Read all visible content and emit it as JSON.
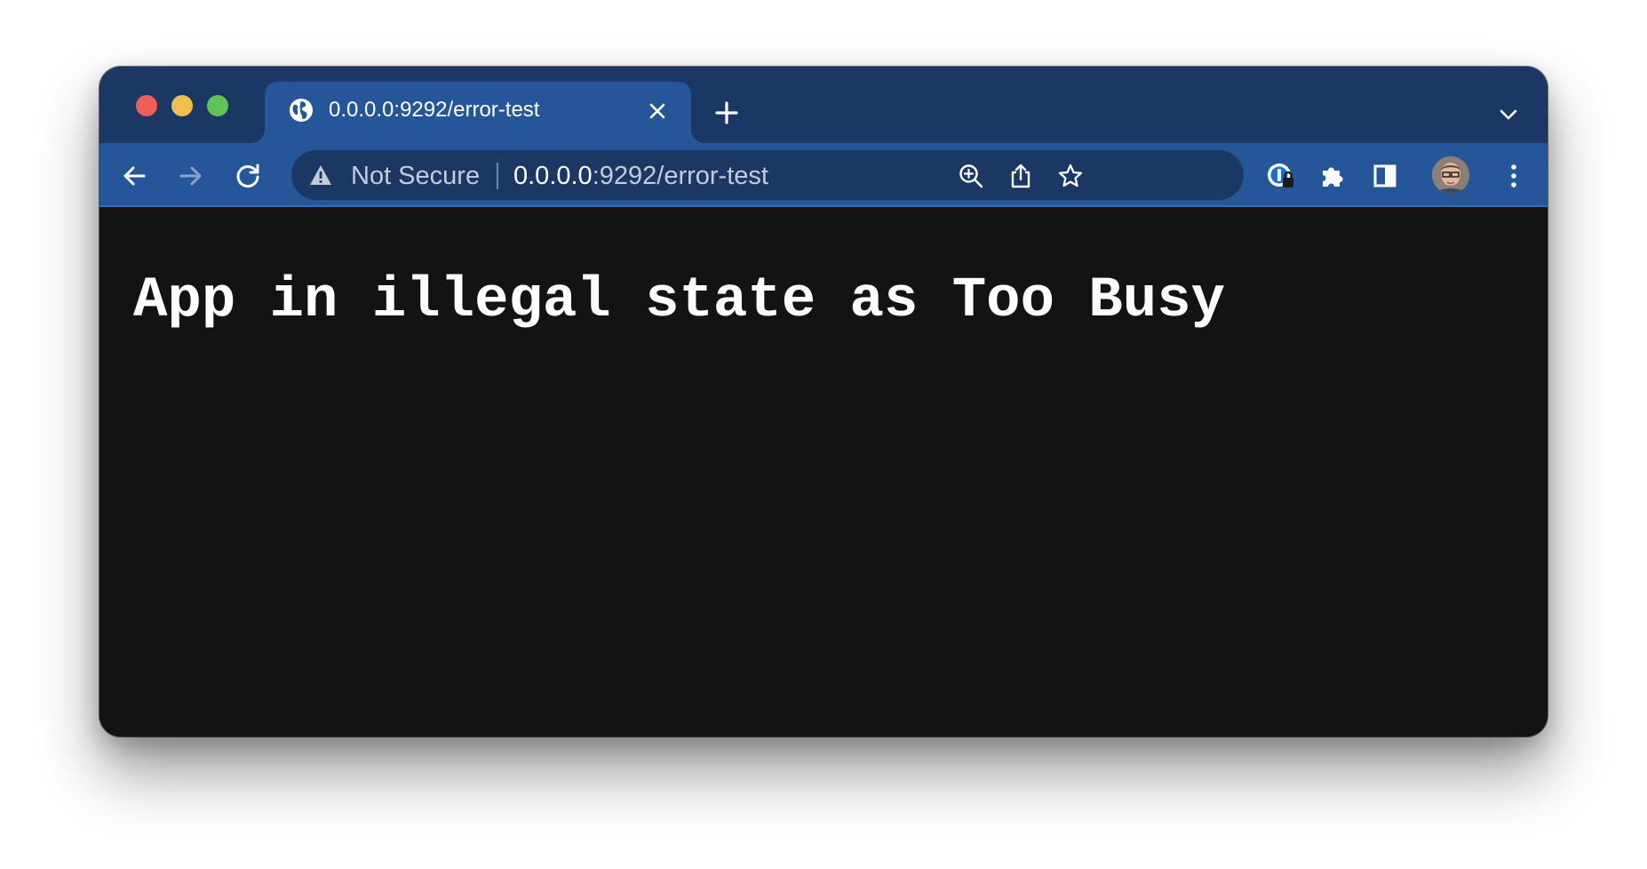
{
  "window": {
    "traffic_lights": {
      "close_color": "#ee5f57",
      "minimize_color": "#f4bd4f",
      "maximize_color": "#5fc454"
    }
  },
  "tab": {
    "favicon": "globe-icon",
    "title": "0.0.0.0:9292/error-test",
    "close_icon": "close-icon"
  },
  "tabstrip": {
    "new_tab_icon": "plus-icon",
    "tab_search_icon": "chevron-down-icon"
  },
  "toolbar": {
    "back_icon": "arrow-left-icon",
    "forward_icon": "arrow-right-icon",
    "forward_enabled": false,
    "reload_icon": "reload-icon",
    "extension_icons": [
      "password-manager-icon",
      "puzzle-icon",
      "side-panel-icon"
    ],
    "menu_icon": "kebab-menu-icon"
  },
  "omnibox": {
    "security_icon": "warning-icon",
    "security_label": "Not Secure",
    "url_host": "0.0.0.0",
    "url_path": ":9292/error-test",
    "zoom_icon": "zoom-in-icon",
    "share_icon": "share-icon",
    "bookmark_icon": "star-icon"
  },
  "colors": {
    "tabstrip_bg": "#1b3763",
    "active_tab_bg": "#26569a",
    "content_bg": "#131313",
    "text": "#ffffff"
  },
  "page": {
    "heading": "App in illegal state as Too Busy"
  }
}
